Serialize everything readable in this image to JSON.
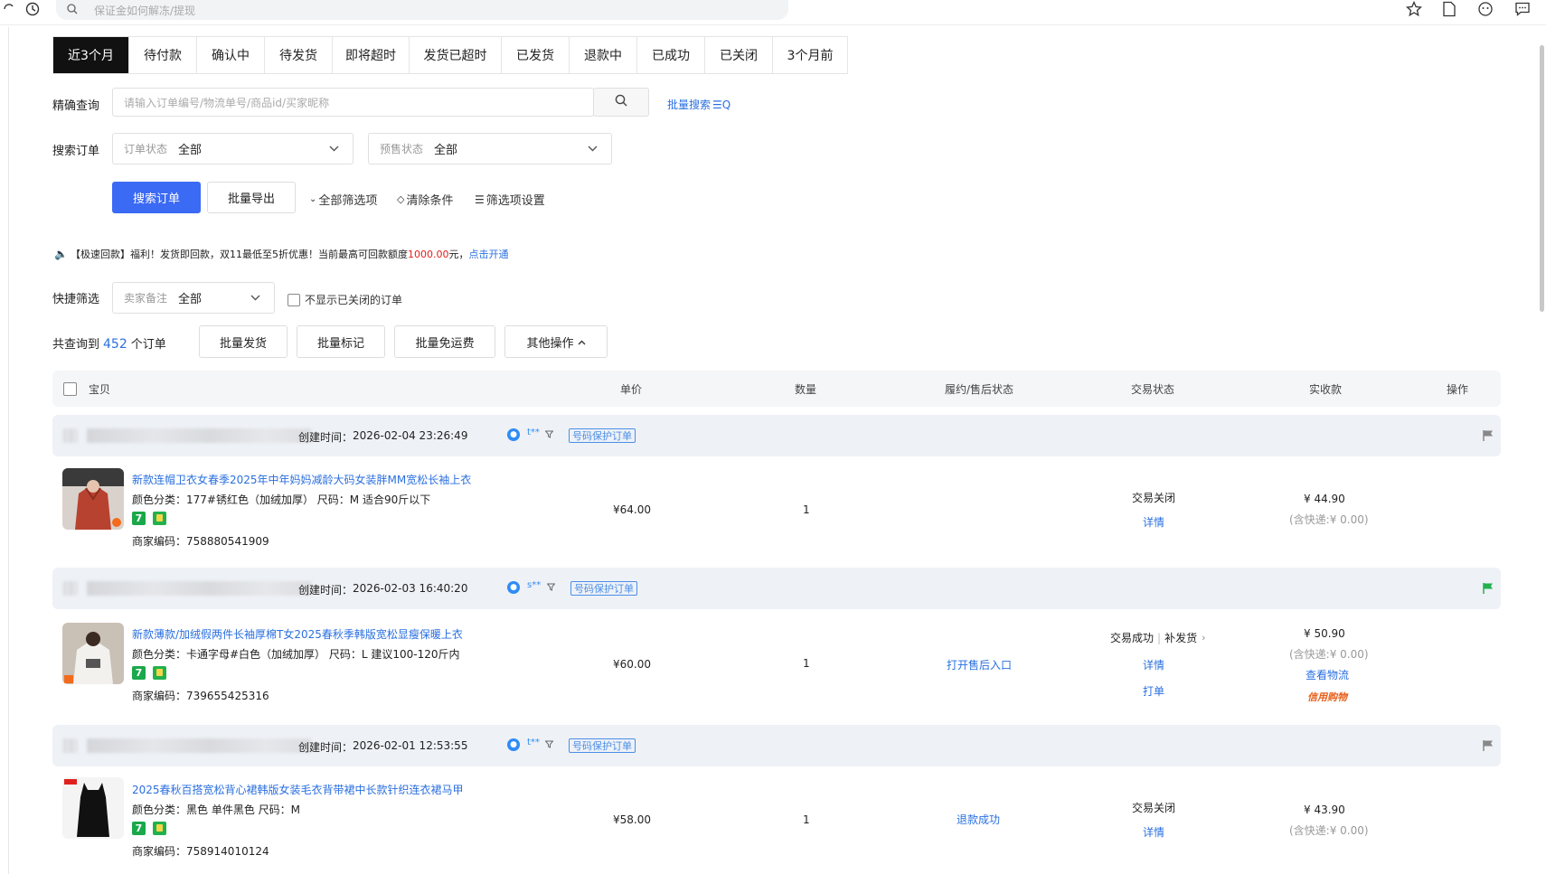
{
  "search": {
    "placeholder": "保证金如何解冻/提现"
  },
  "tabs": [
    "近3个月",
    "待付款",
    "确认中",
    "待发货",
    "即将超时",
    "发货已超时",
    "已发货",
    "退款中",
    "已成功",
    "已关闭",
    "3个月前"
  ],
  "precise": {
    "label": "精确查询",
    "placeholder": "请输入订单编号/物流单号/商品id/买家昵称",
    "batch_search": "批量搜索"
  },
  "filters": {
    "label": "搜索订单",
    "order_status_label": "订单状态",
    "order_status_value": "全部",
    "presale_label": "预售状态",
    "presale_value": "全部"
  },
  "actions": {
    "search_btn": "搜索订单",
    "export_btn": "批量导出",
    "all_filters": "全部筛选项",
    "clear": "清除条件",
    "filter_settings": "筛选项设置"
  },
  "notice": {
    "prefix": "【极速回款】福利！发货即回款，双11最低至5折优惠！当前最高可回款额度",
    "amount": "1000.00",
    "suffix": "元，",
    "link": "点击开通"
  },
  "quick": {
    "label": "快捷筛选",
    "note_label": "卖家备注",
    "note_value": "全部",
    "hide_closed": "不显示已关闭的订单"
  },
  "summary": {
    "prefix": "共查询到",
    "count": "452",
    "suffix": "个订单"
  },
  "bulk": {
    "ship": "批量发货",
    "mark": "批量标记",
    "free_ship": "批量免运费",
    "other": "其他操作"
  },
  "columns": [
    "宝贝",
    "单价",
    "数量",
    "履约/售后状态",
    "交易状态",
    "实收款",
    "操作"
  ],
  "orders": [
    {
      "created_label": "创建时间：",
      "created": "2026-02-04 23:26:49",
      "nick": "t**",
      "badge": "号码保护订单",
      "title": "新款连帽卫衣女春季2025年中年妈妈减龄大码女装胖MM宽松长袖上衣",
      "spec": "颜色分类：177#锈红色（加绒加厚） 尺码：M 适合90斤以下",
      "code": "商家编码：758880541909",
      "price": "¥64.00",
      "qty": "1",
      "after_sale": "",
      "status": "交易关闭",
      "detail": "详情",
      "total": "¥ 44.90",
      "shipping": "(含快递:¥ 0.00)",
      "flag_color": "#888888"
    },
    {
      "created_label": "创建时间：",
      "created": "2026-02-03 16:40:20",
      "nick": "s**",
      "badge": "号码保护订单",
      "title": "新款薄款/加绒假两件长袖厚棉T女2025春秋季韩版宽松显瘦保暖上衣",
      "spec": "颜色分类：卡通字母#白色（加绒加厚） 尺码：L 建议100-120斤内",
      "code": "商家编码：739655425316",
      "price": "¥60.00",
      "qty": "1",
      "after_sale": "打开售后入口",
      "status": "交易成功",
      "status_extra": "补发货",
      "detail": "详情",
      "print": "打单",
      "total": "¥ 50.90",
      "shipping": "(含快递:¥ 0.00)",
      "logistics": "查看物流",
      "credit": "信用购物",
      "flag_color": "#22b14c"
    },
    {
      "created_label": "创建时间：",
      "created": "2026-02-01 12:53:55",
      "nick": "t**",
      "badge": "号码保护订单",
      "title": "2025春秋百搭宽松背心裙韩版女装毛衣背带裙中长款针织连衣裙马甲",
      "spec": "颜色分类：黑色 单件黑色 尺码：M",
      "code": "商家编码：758914010124",
      "price": "¥58.00",
      "qty": "1",
      "after_sale": "退款成功",
      "status": "交易关闭",
      "detail": "详情",
      "total": "¥ 43.90",
      "shipping": "(含快递:¥ 0.00)",
      "flag_color": "#888888"
    }
  ],
  "colors": {
    "primary": "#3b6af5",
    "link": "#2a6fe0",
    "active_tab": "#111111",
    "warn": "#e0201e"
  }
}
